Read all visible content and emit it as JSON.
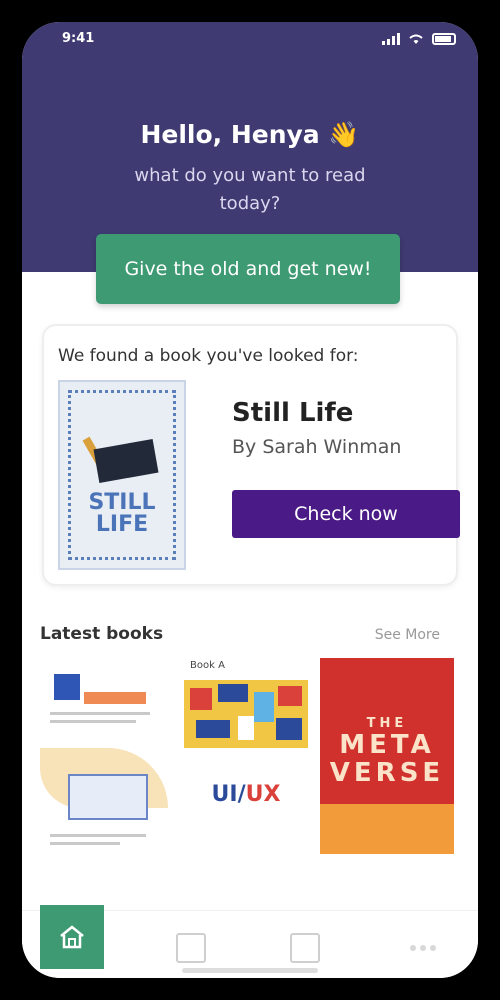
{
  "status_bar": {
    "time": "9:41"
  },
  "header": {
    "greeting": "Hello, Henya",
    "greeting_emoji": "👋",
    "subtext": "what do you want to read today?"
  },
  "promo": {
    "label": "Give the old and get new!"
  },
  "found_card": {
    "title": "We found a book you've looked for:",
    "book_title": "Still Life",
    "book_author": "By Sarah Winman",
    "cover_title": "STILL LIFE",
    "button_label": "Check now"
  },
  "latest": {
    "title": "Latest books",
    "see_more": "See More",
    "books": [
      {
        "cover_head": "",
        "cover_main": ""
      },
      {
        "cover_head": "Book A",
        "cover_small": "",
        "cover_ui": "UI",
        "cover_ux": "UX",
        "cover_author": ""
      },
      {
        "cover_the": "THE",
        "cover_meta": "META",
        "cover_verse": "VERSE"
      }
    ]
  },
  "nav": {
    "items": [
      "home-icon",
      "book-icon",
      "doc-icon",
      "more-icon"
    ]
  },
  "colors": {
    "hero": "#3f3a72",
    "accent_green": "#3e9a73",
    "accent_purple": "#4a1a86"
  }
}
